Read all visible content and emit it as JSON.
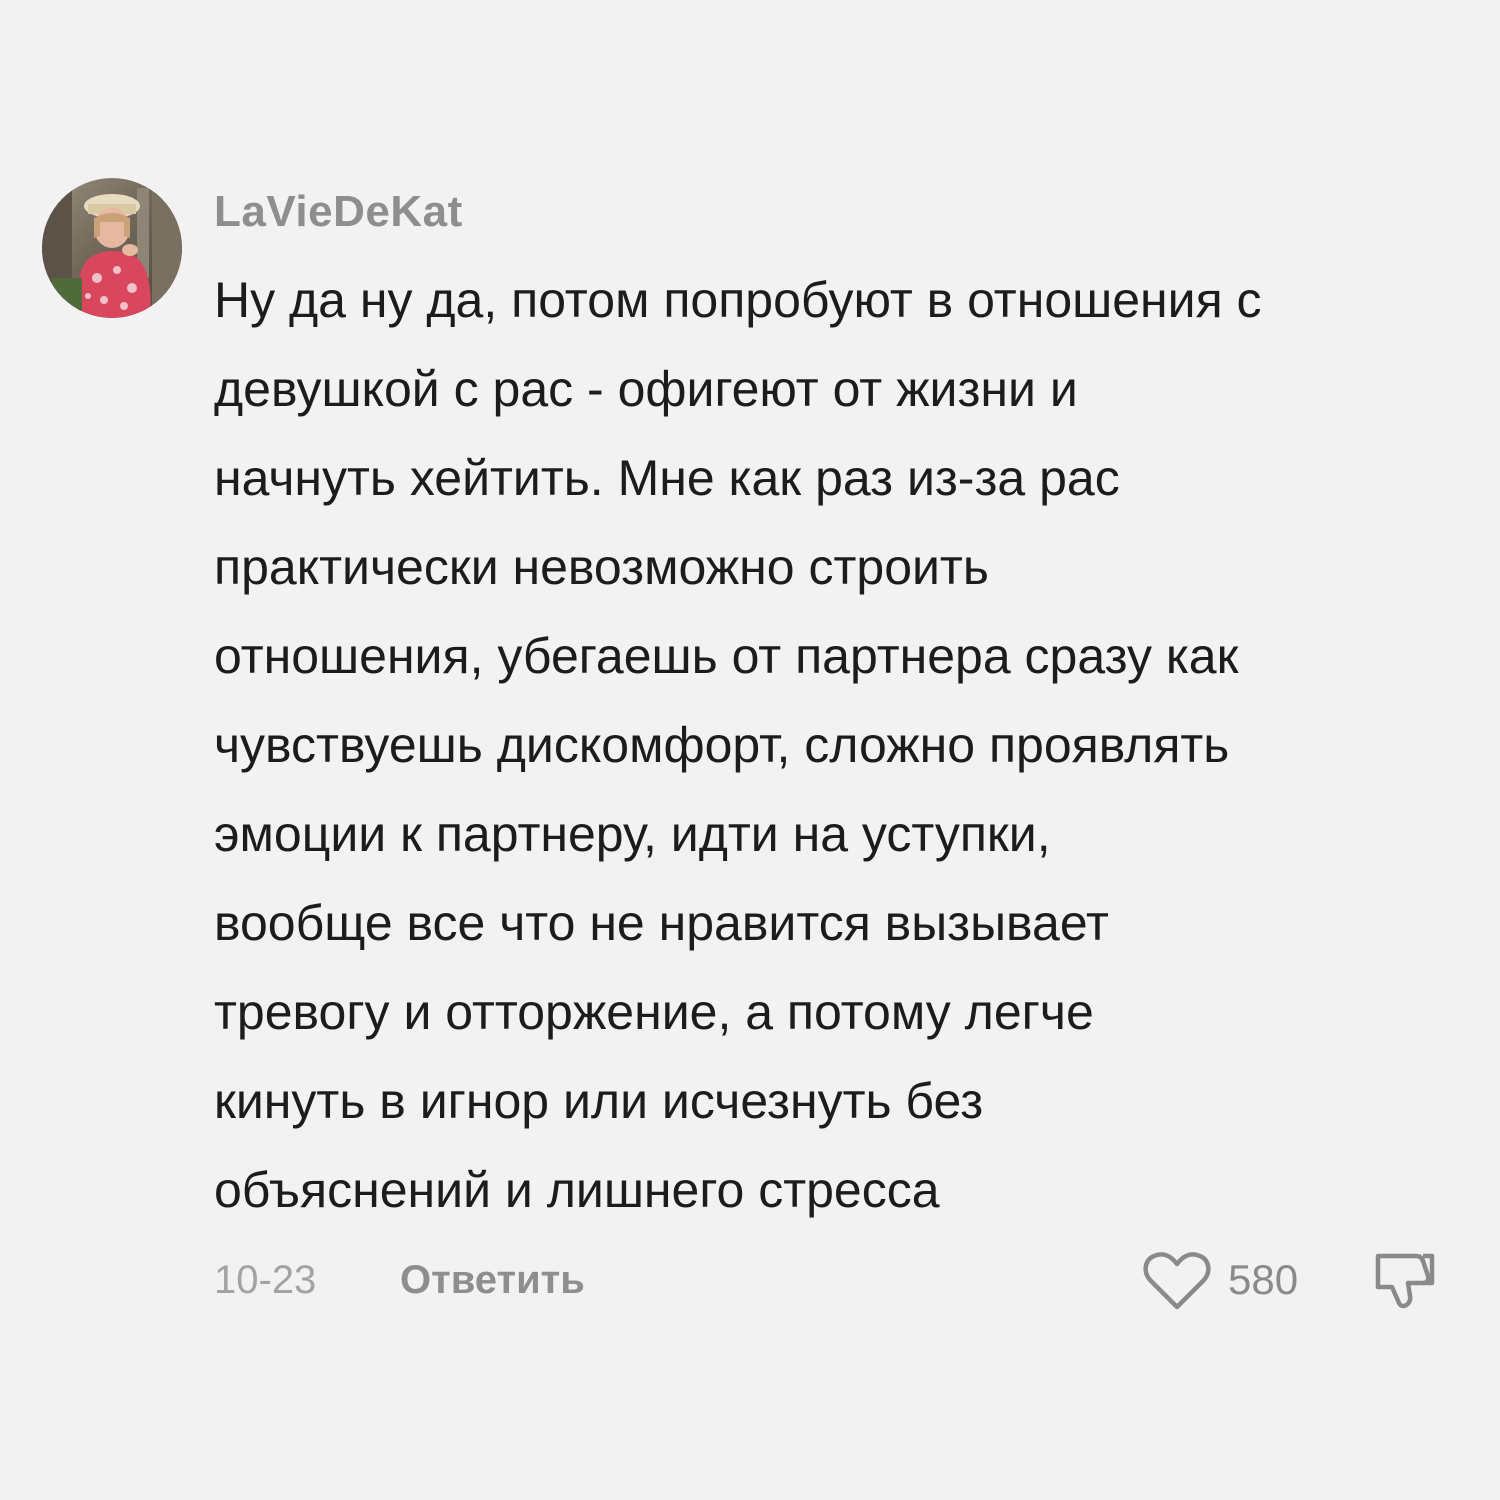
{
  "comment": {
    "username": "LaVieDeKat",
    "avatar_icon": "user-avatar-photo",
    "text_lines": [
      "Ну да ну да, потом попробуют в отношения с",
      "девушкой с рас - офигеют от жизни и",
      "начнуть хейтить. Мне как раз из-за рас",
      "практически невозможно строить",
      "отношения, убегаешь от партнера сразу как",
      "чувствуешь дискомфорт, сложно проявлять",
      "эмоции к партнеру, идти на уступки,",
      "вообще все что не нравится вызывает",
      "тревогу и отторжение, а потому легче",
      "кинуть в игнор или исчезнуть без",
      "объяснений и лишнего стресса"
    ],
    "date": "10-23",
    "reply_label": "Ответить",
    "like_icon": "heart-outline-icon",
    "like_count": "580",
    "dislike_icon": "thumbs-down-outline-icon"
  },
  "colors": {
    "background": "#f2f2f2",
    "text": "#1c1c1c",
    "muted": "#8e8e8e",
    "date": "#a3a3a3"
  }
}
